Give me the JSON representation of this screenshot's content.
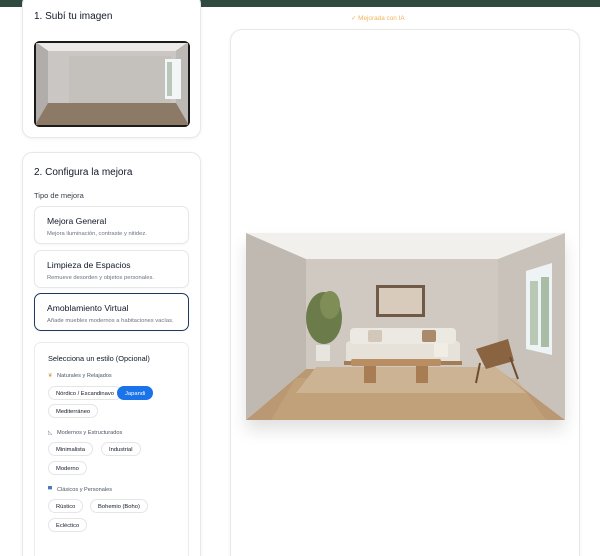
{
  "upload": {
    "title": "1. Subí tu imagen"
  },
  "config": {
    "title": "2. Configura la mejora",
    "tipo_label": "Tipo de mejora",
    "options": [
      {
        "title": "Mejora General",
        "desc": "Mejora iluminación, contraste y nitidez.",
        "selected": false
      },
      {
        "title": "Limpieza de Espacios",
        "desc": "Remueve desorden y objetos personales.",
        "selected": false
      },
      {
        "title": "Amoblamiento Virtual",
        "desc": "Añade muebles modernos a habitaciones vacías.",
        "selected": true
      }
    ],
    "styles": {
      "title": "Selecciona un estilo (Opcional)",
      "groups": [
        {
          "label": "Naturales y Relajados",
          "icon": "leaf-icon",
          "chips": [
            "Nórdico / Escandinavo",
            "Japandi",
            "Mediterráneo"
          ]
        },
        {
          "label": "Modernos y Estructurados",
          "icon": "ruler-icon",
          "chips": [
            "Minimalista",
            "Industrial",
            "Moderno"
          ]
        },
        {
          "label": "Clásicos y Personales",
          "icon": "frame-icon",
          "chips": [
            "Rústico",
            "Bohemio (Boho)",
            "Ecléctico"
          ]
        }
      ],
      "selected": "Japandi"
    }
  },
  "result": {
    "badge": "✓ Mejorada con IA"
  },
  "colors": {
    "topbar": "#2f4a3e",
    "accent": "#1a73e8",
    "selected_border": "#1e3a5f",
    "badge": "#f0b45a"
  }
}
